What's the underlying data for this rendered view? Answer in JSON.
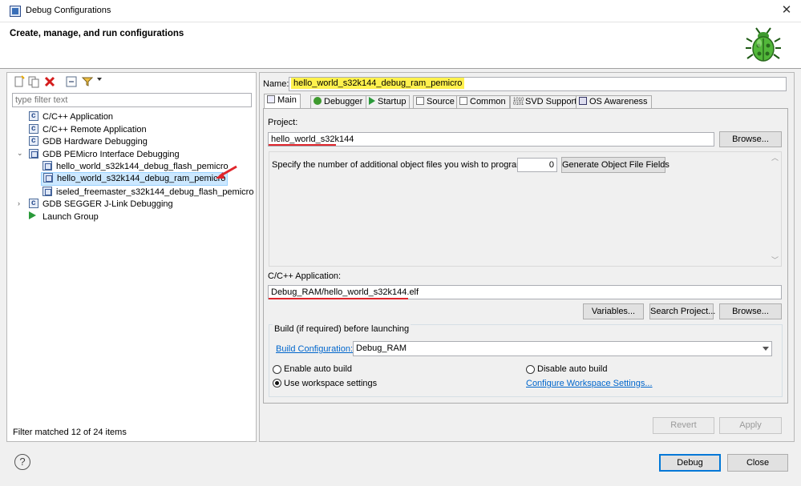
{
  "window": {
    "title": "Debug Configurations",
    "close_symbol": "✕"
  },
  "banner": {
    "title": "Create, manage, and run configurations",
    "icon": "debug-bug-icon"
  },
  "left": {
    "filter_placeholder": "type filter text",
    "tree": [
      {
        "label": "C/C++ Application",
        "icon": "c-config-icon"
      },
      {
        "label": "C/C++ Remote Application",
        "icon": "c-config-icon"
      },
      {
        "label": "GDB Hardware Debugging",
        "icon": "c-config-icon"
      },
      {
        "label": "GDB PEMicro Interface Debugging",
        "icon": "pemicro-icon",
        "expanded": true
      },
      {
        "label": "hello_world_s32k144_debug_flash_pemicro",
        "icon": "pemicro-icon"
      },
      {
        "label": "hello_world_s32k144_debug_ram_pemicro",
        "icon": "pemicro-icon",
        "selected": true
      },
      {
        "label": "iseled_freemaster_s32k144_debug_flash_pemicro",
        "icon": "pemicro-icon"
      },
      {
        "label": "GDB SEGGER J-Link Debugging",
        "icon": "c-config-icon",
        "expanded": false
      },
      {
        "label": "Launch Group",
        "icon": "launch-icon"
      }
    ],
    "status": "Filter matched 12 of 24 items"
  },
  "right": {
    "name_label": "Name:",
    "name_value": "hello_world_s32k144_debug_ram_pemicro",
    "tabs": [
      {
        "label": "Main",
        "active": true
      },
      {
        "label": "Debugger"
      },
      {
        "label": "Startup"
      },
      {
        "label": "Source"
      },
      {
        "label": "Common"
      },
      {
        "label": "SVD Support"
      },
      {
        "label": "OS Awareness"
      }
    ],
    "project_label": "Project:",
    "project_value": "hello_world_s32k144",
    "browse_label": "Browse...",
    "object_files_label": "Specify the number of additional object files you wish to program:",
    "object_files_value": "0",
    "generate_button": "Generate Object File Fields",
    "app_label": "C/C++ Application:",
    "app_value": "Debug_RAM/hello_world_s32k144.elf",
    "variables_button": "Variables...",
    "search_project_button": "Search Project...",
    "browse2_label": "Browse...",
    "build_group_title": "Build (if required) before launching",
    "build_config_link": "Build Configuration:",
    "build_config_value": "Debug_RAM",
    "enable_auto_build": "Enable auto build",
    "disable_auto_build": "Disable auto build",
    "use_workspace": "Use workspace settings",
    "configure_workspace": "Configure Workspace Settings...",
    "revert_button": "Revert",
    "apply_button": "Apply"
  },
  "footer": {
    "help_symbol": "?",
    "debug_button": "Debug",
    "close_button": "Close"
  },
  "colors": {
    "highlight": "#fff14d",
    "annotation_red": "#e0262c",
    "selection": "#cce8ff",
    "link": "#0066cc"
  }
}
